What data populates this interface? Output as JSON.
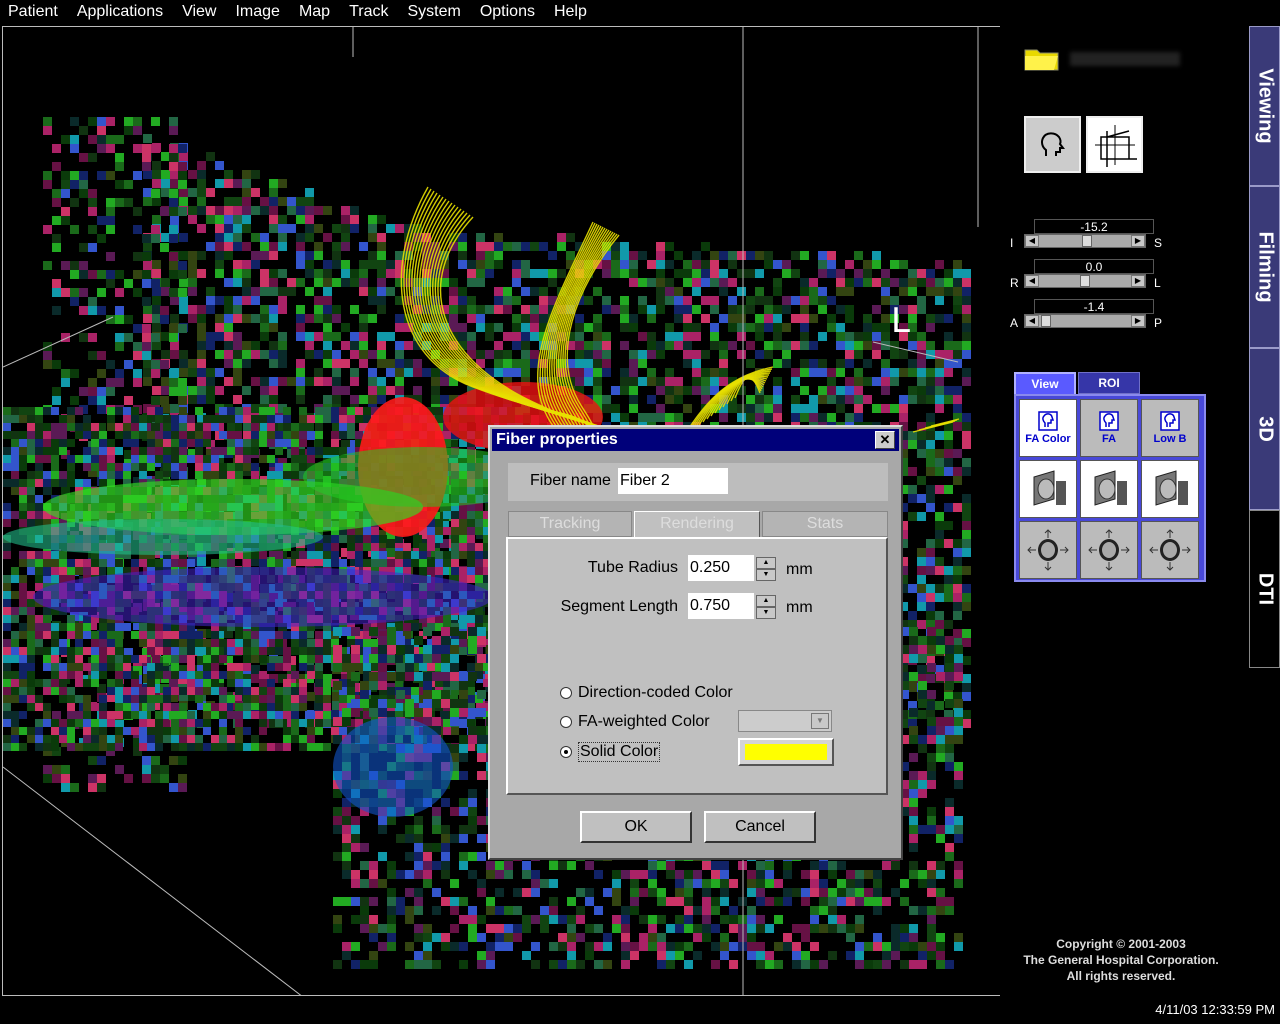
{
  "menu": [
    "Patient",
    "Applications",
    "View",
    "Image",
    "Map",
    "Track",
    "System",
    "Options",
    "Help"
  ],
  "viewport": {
    "orientation_label": "L"
  },
  "sliders": [
    {
      "left": "I",
      "right": "S",
      "value": "-15.2",
      "position": 0.52
    },
    {
      "left": "R",
      "right": "L",
      "value": "0.0",
      "position": 0.5
    },
    {
      "left": "A",
      "right": "P",
      "value": "-1.4",
      "position": 0.02
    }
  ],
  "view_panel": {
    "tabs": [
      "View",
      "ROI"
    ],
    "buttons": [
      {
        "label": "FA Color",
        "icon": "head-icon"
      },
      {
        "label": "FA",
        "icon": "head-icon"
      },
      {
        "label": "Low B",
        "icon": "head-icon"
      },
      {
        "label": "",
        "icon": "sagittal-slice-icon"
      },
      {
        "label": "",
        "icon": "coronal-slice-icon"
      },
      {
        "label": "",
        "icon": "axial-slice-icon"
      },
      {
        "label": "",
        "icon": "sagittal-move-icon"
      },
      {
        "label": "",
        "icon": "coronal-move-icon"
      },
      {
        "label": "",
        "icon": "axial-move-icon"
      }
    ]
  },
  "side_tabs": [
    "Viewing",
    "Filming",
    "3D",
    "DTI"
  ],
  "copyright": [
    "Copyright © 2001-2003",
    "The General Hospital Corporation.",
    "All rights reserved."
  ],
  "clock": "4/11/03 12:33:59 PM",
  "dialog": {
    "title": "Fiber properties",
    "close": "✕",
    "fiber_name_label": "Fiber name",
    "fiber_name_value": "Fiber 2",
    "tabs": [
      "Tracking",
      "Rendering",
      "Stats"
    ],
    "tube_radius_label": "Tube Radius",
    "tube_radius_value": "0.250",
    "segment_length_label": "Segment Length",
    "segment_length_value": "0.750",
    "unit": "mm",
    "color_options": [
      "Direction-coded Color",
      "FA-weighted Color",
      "Solid Color"
    ],
    "selected_color_option": "Solid Color",
    "solid_color": "#ffff00",
    "ok": "OK",
    "cancel": "Cancel"
  },
  "colors": {
    "dialog_title_bar": "#00007a",
    "panel_blue": "#4848d8",
    "fiber_yellow": "#e8e000"
  }
}
